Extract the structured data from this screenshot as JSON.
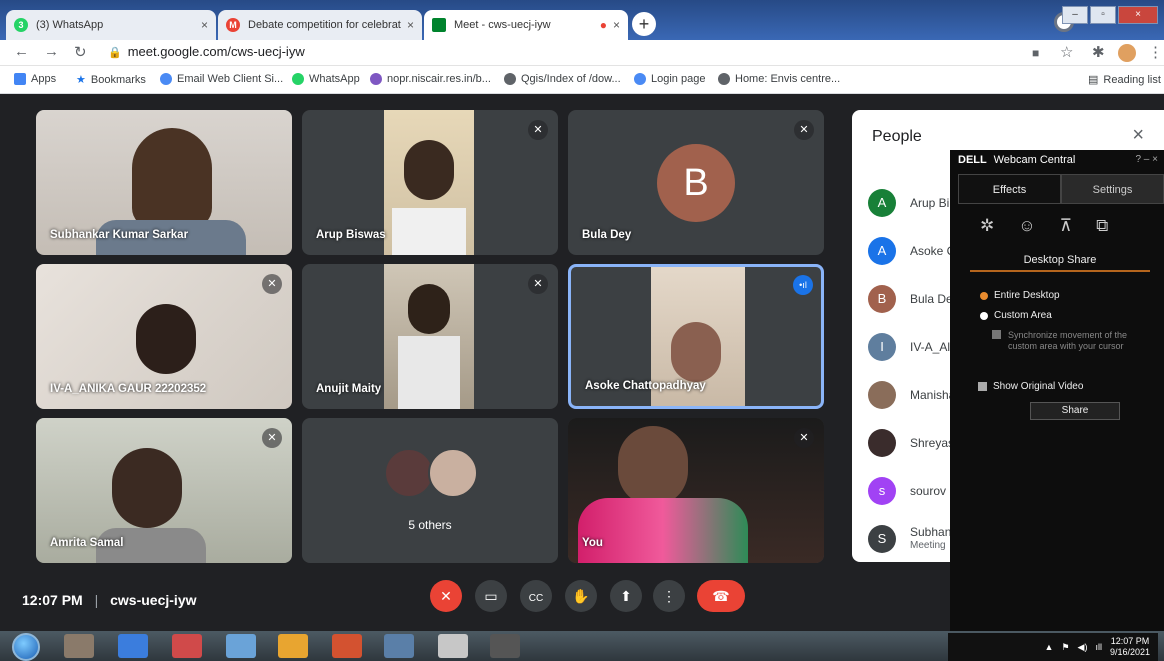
{
  "browser": {
    "tabs": [
      {
        "title": "(3) WhatsApp",
        "close": "×",
        "favicon_color": "#25d366"
      },
      {
        "title": "Debate competition for celebrati",
        "close": "×",
        "favicon_color": "#ea4335"
      },
      {
        "title": "Meet - cws-uecj-iyw",
        "close": "×",
        "favicon_color": "#00832d"
      }
    ],
    "new_tab": "+",
    "url": "meet.google.com/cws-uecj-iyw",
    "bookmarks": [
      {
        "label": "Apps",
        "icon": "apps-icon",
        "color": "#4285f4"
      },
      {
        "label": "Bookmarks",
        "icon": "star-icon",
        "color": "#1a73e8"
      },
      {
        "label": "Email Web Client Si...",
        "icon": "globe-icon",
        "color": "#4a8af4"
      },
      {
        "label": "WhatsApp",
        "icon": "whatsapp-icon",
        "color": "#25d366"
      },
      {
        "label": "nopr.niscair.res.in/b...",
        "icon": "tool-icon",
        "color": "#7e57c2"
      },
      {
        "label": "Qgis/Index of /dow...",
        "icon": "globe-icon",
        "color": "#5f6368"
      },
      {
        "label": "Login page",
        "icon": "globe-icon",
        "color": "#4a8af4"
      },
      {
        "label": "Home: Envis centre...",
        "icon": "globe-icon",
        "color": "#5f6368"
      }
    ],
    "reading_list": "Reading list"
  },
  "meet": {
    "tiles": [
      {
        "name": "Subhankar Kumar Sarkar",
        "muted": false
      },
      {
        "name": "Arup Biswas",
        "muted": true
      },
      {
        "name": "Bula Dey",
        "muted": true,
        "avatar_letter": "B"
      },
      {
        "name": "IV-A_ANIKA GAUR 22202352",
        "muted": true
      },
      {
        "name": "Anujit Maity",
        "muted": true
      },
      {
        "name": "Asoke Chattopadhyay",
        "muted": false,
        "speaking": true
      },
      {
        "name": "Amrita Samal",
        "muted": true
      },
      {
        "name": "5 others",
        "muted": false
      },
      {
        "name": "You",
        "muted": true
      }
    ],
    "time": "12:07 PM",
    "separator": "|",
    "meeting_code": "cws-uecj-iyw",
    "controls": [
      "mic-off-icon",
      "camera-icon",
      "captions-icon",
      "raise-hand-icon",
      "present-icon",
      "more-icon",
      "end-call-icon"
    ]
  },
  "people": {
    "title": "People",
    "close": "×",
    "list": [
      {
        "letter": "A",
        "name": "Arup Bi",
        "color": "#188038"
      },
      {
        "letter": "A",
        "name": "Asoke C",
        "color": "#1a73e8"
      },
      {
        "letter": "B",
        "name": "Bula De",
        "color": "#a1614d"
      },
      {
        "letter": "I",
        "name": "IV-A_Al",
        "color": "#5f7e9e"
      },
      {
        "letter": "",
        "name": "Manisha",
        "color": "#8a6d5a"
      },
      {
        "letter": "",
        "name": "Shreyas",
        "color": "#3a2c2c"
      },
      {
        "letter": "s",
        "name": "sourov",
        "color": "#a142f4"
      },
      {
        "letter": "S",
        "name": "Subhan",
        "sub": "Meeting",
        "color": "#3c4043"
      }
    ]
  },
  "dell": {
    "brand": "DELL",
    "title": "Webcam Central",
    "controls": "?  –  ×",
    "tabs": [
      "Effects",
      "Settings"
    ],
    "section": "Desktop Share",
    "options": [
      "Entire Desktop",
      "Custom Area"
    ],
    "sync_note": "Synchronize movement of the custom area with your cursor",
    "show_original": "Show Original Video",
    "share_btn": "Share"
  },
  "taskbar": {
    "clock_time": "12:07 PM",
    "clock_date": "9/16/2021"
  }
}
